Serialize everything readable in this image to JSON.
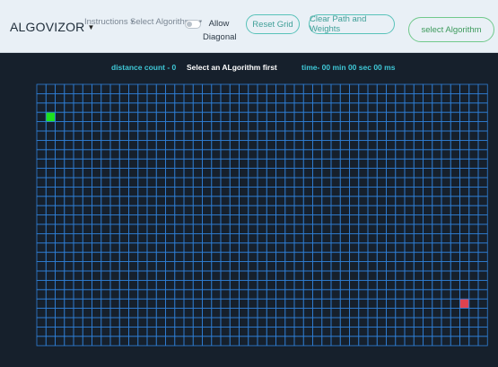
{
  "navbar": {
    "brand": "ALGOVIZOR",
    "instructions_label": "Instructions",
    "select_algorithms_label": "Select Algorithms",
    "allow_diagonal_label": "Allow Diagonal",
    "allow_diagonal_checked": false,
    "reset_grid_label": "Reset Grid",
    "clear_path_label": "Clear Path and Weights",
    "select_algorithm_button_label": "select Algorithm"
  },
  "status": {
    "distance_text": "distance count - 0",
    "algorithm_text": "Select an ALgorithm first",
    "time_text": "time- 00 min 00 sec 00 ms"
  },
  "grid": {
    "columns": 49,
    "rows": 28,
    "start_cell": {
      "col": 1,
      "row": 3
    },
    "end_cell": {
      "col": 46,
      "row": 23
    }
  },
  "colors": {
    "background": "#16202c",
    "grid_line": "#2f7fd6",
    "start": "#1ee01e",
    "end": "#e0424f",
    "status_cyan": "#3fc7d6",
    "status_white": "#ffffff"
  }
}
